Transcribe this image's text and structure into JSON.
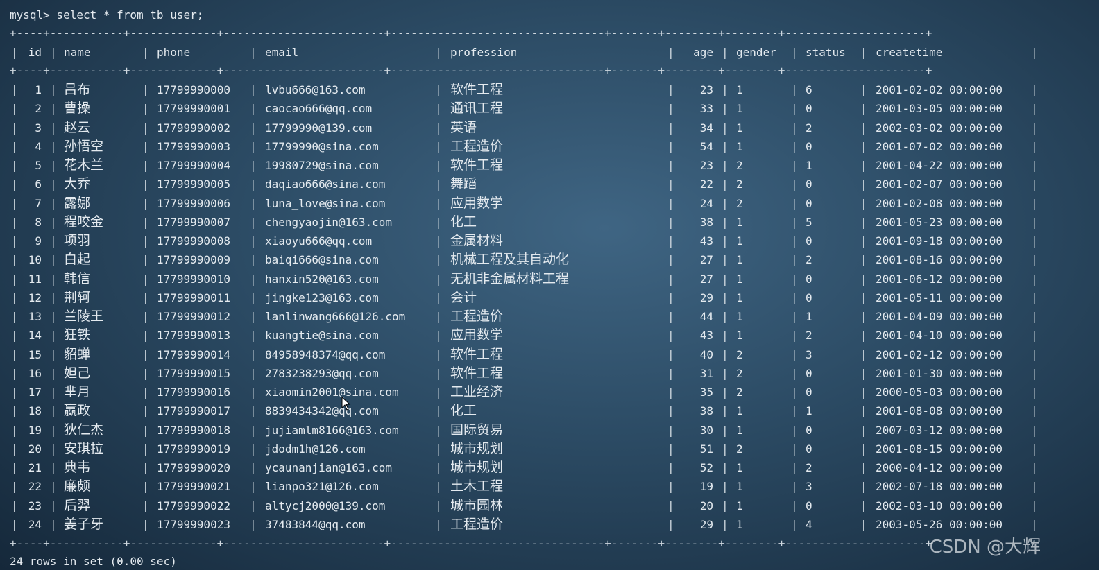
{
  "terminal": {
    "prompt_line": "mysql> select * from tb_user;",
    "footer_line": "24 rows in set (0.00 sec)",
    "border_line": "+----+-----------+-------------+------------------------+--------------------------------+-------+--------+--------+---------------------+",
    "headers": [
      "id",
      "name",
      "phone",
      "email",
      "profession",
      "age",
      "gender",
      "status",
      "createtime"
    ],
    "rows": [
      [
        "1",
        "吕布",
        "17799990000",
        "lvbu666@163.com",
        "软件工程",
        "23",
        "1",
        "6",
        "2001-02-02 00:00:00"
      ],
      [
        "2",
        "曹操",
        "17799990001",
        "caocao666@qq.com",
        "通讯工程",
        "33",
        "1",
        "0",
        "2001-03-05 00:00:00"
      ],
      [
        "3",
        "赵云",
        "17799990002",
        "17799990@139.com",
        "英语",
        "34",
        "1",
        "2",
        "2002-03-02 00:00:00"
      ],
      [
        "4",
        "孙悟空",
        "17799990003",
        "17799990@sina.com",
        "工程造价",
        "54",
        "1",
        "0",
        "2001-07-02 00:00:00"
      ],
      [
        "5",
        "花木兰",
        "17799990004",
        "19980729@sina.com",
        "软件工程",
        "23",
        "2",
        "1",
        "2001-04-22 00:00:00"
      ],
      [
        "6",
        "大乔",
        "17799990005",
        "daqiao666@sina.com",
        "舞蹈",
        "22",
        "2",
        "0",
        "2001-02-07 00:00:00"
      ],
      [
        "7",
        "露娜",
        "17799990006",
        "luna_love@sina.com",
        "应用数学",
        "24",
        "2",
        "0",
        "2001-02-08 00:00:00"
      ],
      [
        "8",
        "程咬金",
        "17799990007",
        "chengyaojin@163.com",
        "化工",
        "38",
        "1",
        "5",
        "2001-05-23 00:00:00"
      ],
      [
        "9",
        "项羽",
        "17799990008",
        "xiaoyu666@qq.com",
        "金属材料",
        "43",
        "1",
        "0",
        "2001-09-18 00:00:00"
      ],
      [
        "10",
        "白起",
        "17799990009",
        "baiqi666@sina.com",
        "机械工程及其自动化",
        "27",
        "1",
        "2",
        "2001-08-16 00:00:00"
      ],
      [
        "11",
        "韩信",
        "17799990010",
        "hanxin520@163.com",
        "无机非金属材料工程",
        "27",
        "1",
        "0",
        "2001-06-12 00:00:00"
      ],
      [
        "12",
        "荆轲",
        "17799990011",
        "jingke123@163.com",
        "会计",
        "29",
        "1",
        "0",
        "2001-05-11 00:00:00"
      ],
      [
        "13",
        "兰陵王",
        "17799990012",
        "lanlinwang666@126.com",
        "工程造价",
        "44",
        "1",
        "1",
        "2001-04-09 00:00:00"
      ],
      [
        "14",
        "狂铁",
        "17799990013",
        "kuangtie@sina.com",
        "应用数学",
        "43",
        "1",
        "2",
        "2001-04-10 00:00:00"
      ],
      [
        "15",
        "貂蝉",
        "17799990014",
        "84958948374@qq.com",
        "软件工程",
        "40",
        "2",
        "3",
        "2001-02-12 00:00:00"
      ],
      [
        "16",
        "妲己",
        "17799990015",
        "2783238293@qq.com",
        "软件工程",
        "31",
        "2",
        "0",
        "2001-01-30 00:00:00"
      ],
      [
        "17",
        "芈月",
        "17799990016",
        "xiaomin2001@sina.com",
        "工业经济",
        "35",
        "2",
        "0",
        "2000-05-03 00:00:00"
      ],
      [
        "18",
        "嬴政",
        "17799990017",
        "8839434342@qq.com",
        "化工",
        "38",
        "1",
        "1",
        "2001-08-08 00:00:00"
      ],
      [
        "19",
        "狄仁杰",
        "17799990018",
        "jujiamlm8166@163.com",
        "国际贸易",
        "30",
        "1",
        "0",
        "2007-03-12 00:00:00"
      ],
      [
        "20",
        "安琪拉",
        "17799990019",
        "jdodm1h@126.com",
        "城市规划",
        "51",
        "2",
        "0",
        "2001-08-15 00:00:00"
      ],
      [
        "21",
        "典韦",
        "17799990020",
        "ycaunanjian@163.com",
        "城市规划",
        "52",
        "1",
        "2",
        "2000-04-12 00:00:00"
      ],
      [
        "22",
        "廉颇",
        "17799990021",
        "lianpo321@126.com",
        "土木工程",
        "19",
        "1",
        "3",
        "2002-07-18 00:00:00"
      ],
      [
        "23",
        "后羿",
        "17799990022",
        "altycj2000@139.com",
        "城市园林",
        "20",
        "1",
        "0",
        "2002-03-10 00:00:00"
      ],
      [
        "24",
        "姜子牙",
        "17799990023",
        "37483844@qq.com",
        "工程造价",
        "29",
        "1",
        "4",
        "2003-05-26 00:00:00"
      ]
    ],
    "watermark": "CSDN @大辉",
    "icons": {
      "cursor": "mouse-pointer-icon"
    }
  }
}
